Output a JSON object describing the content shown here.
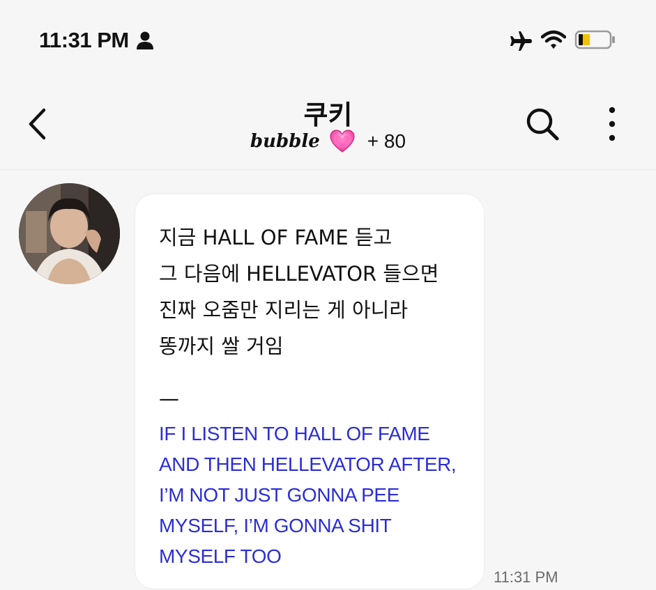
{
  "status_bar": {
    "time": "11:31 PM",
    "icons": [
      "person-icon",
      "airplane-icon",
      "wifi-icon",
      "battery-icon"
    ],
    "battery_color": "#f2c200"
  },
  "header": {
    "title": "쿠키",
    "brand": "bubble",
    "subscriber_count": "+ 80",
    "icons": [
      "back-icon",
      "heart-icon",
      "search-icon",
      "more-icon"
    ]
  },
  "message": {
    "korean_lines": [
      "지금 HALL OF FAME 듣고",
      "그 다음에 HELLEVATOR 들으면",
      "진짜 오줌만 지리는 게 아니라",
      "똥까지 쌀 거임"
    ],
    "separator": "—",
    "english_lines": [
      "IF I LISTEN TO HALL OF FAME",
      "AND THEN HELLEVATOR AFTER,",
      "I’M NOT JUST GONNA PEE",
      "MYSELF, I’M GONNA SHIT",
      "MYSELF TOO"
    ],
    "time": "11:31 PM",
    "translation_color": "#2b2ed6"
  }
}
